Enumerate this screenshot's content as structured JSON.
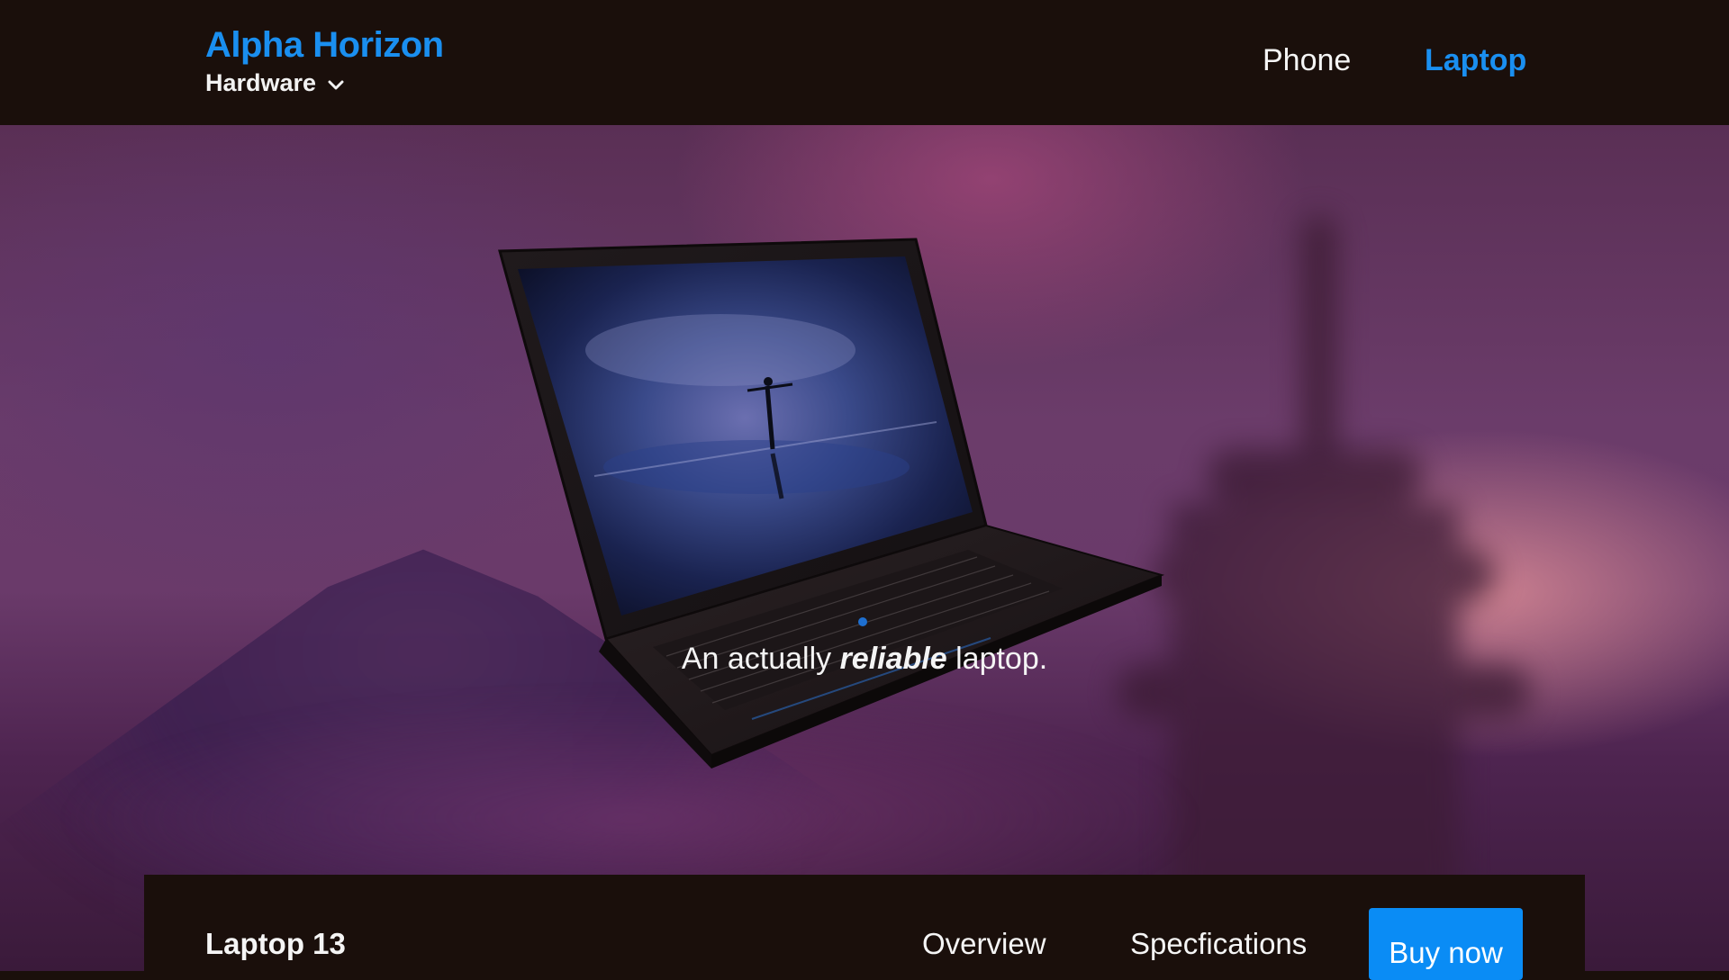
{
  "header": {
    "brand": "Alpha Horizon",
    "category_label": "Hardware",
    "category_icon": "chevron-down-icon",
    "nav": [
      {
        "label": "Phone",
        "active": false
      },
      {
        "label": "Laptop",
        "active": true
      }
    ]
  },
  "hero": {
    "tagline": {
      "before": "An actually ",
      "emphasis": "reliable",
      "after": " laptop."
    }
  },
  "subnav": {
    "product_name": "Laptop 13",
    "links": [
      "Overview",
      "Specfications"
    ],
    "cta_label": "Buy now"
  },
  "colors": {
    "accent": "#1a8ff0",
    "cta": "#0a8cf5",
    "bar_background": "#1a0f0b"
  }
}
